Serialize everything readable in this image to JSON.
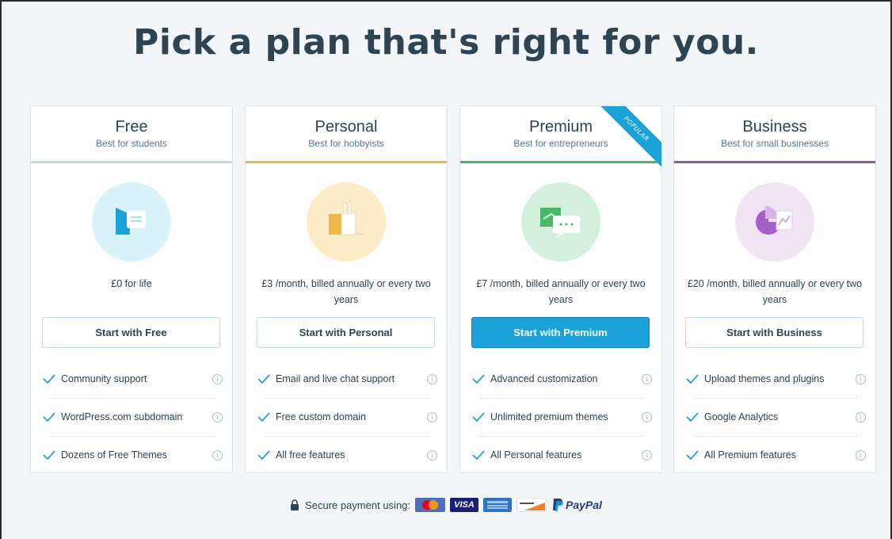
{
  "headline": "Pick a plan that's right for you.",
  "plans": [
    {
      "name": "Free",
      "tagline": "Best for students",
      "accent": "#c8d7e1",
      "icon_bg": "#d9f3fb",
      "icon": "chat-bubble-icon",
      "price": "£0 for life",
      "cta": "Start with Free",
      "features": [
        "Community support",
        "WordPress.com subdomain",
        "Dozens of Free Themes"
      ]
    },
    {
      "name": "Personal",
      "tagline": "Best for hobbyists",
      "accent": "#f0b849",
      "icon_bg": "#fdecc8",
      "icon": "pencil-cup-icon",
      "price": "£3 /month, billed annually or every two years",
      "cta": "Start with Personal",
      "features": [
        "Email and live chat support",
        "Free custom domain",
        "All free features"
      ]
    },
    {
      "name": "Premium",
      "tagline": "Best for entrepreneurs",
      "accent": "#4ab866",
      "icon_bg": "#d3f0dd",
      "icon": "chat-window-icon",
      "price": "£7 /month, billed annually or every two years",
      "cta": "Start with Premium",
      "badge": "POPULAR",
      "features": [
        "Advanced customization",
        "Unlimited premium themes",
        "All Personal features"
      ]
    },
    {
      "name": "Business",
      "tagline": "Best for small businesses",
      "accent": "#8f58b6",
      "icon_bg": "#f2e3f5",
      "icon": "pie-chart-icon",
      "price": "£20 /month, billed annually or every two years",
      "cta": "Start with Business",
      "features": [
        "Upload themes and plugins",
        "Google Analytics",
        "All Premium features"
      ]
    }
  ],
  "secure": {
    "label": "Secure payment using:",
    "methods": [
      "Mastercard",
      "VISA",
      "American Express",
      "DISCOVER",
      "PayPal"
    ]
  },
  "colors": {
    "primary_button": "#1ba2d8",
    "text": "#2e4453",
    "check": "#1ba2d8"
  }
}
